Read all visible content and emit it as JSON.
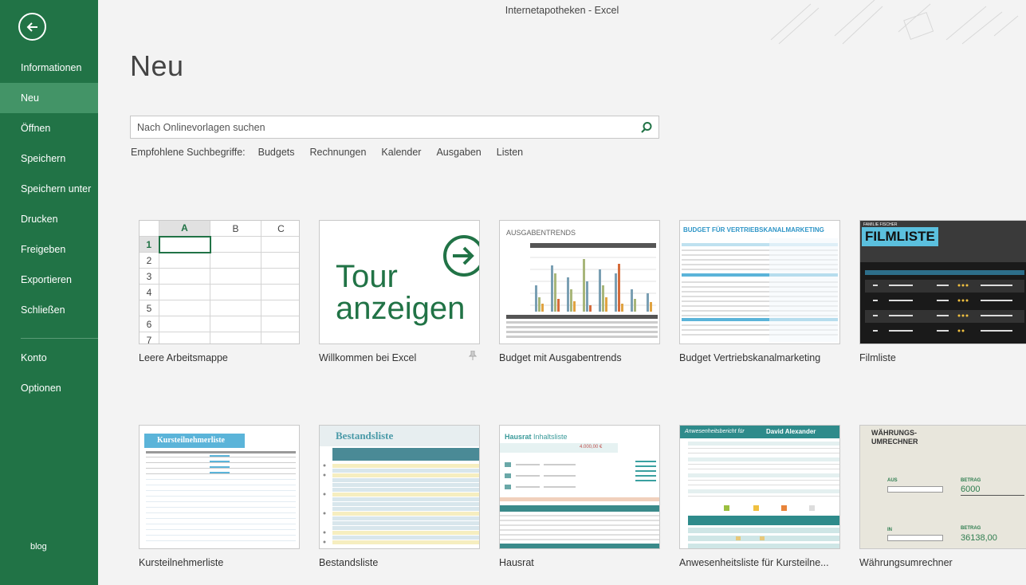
{
  "window": {
    "title": "Internetapotheken - Excel"
  },
  "sidebar": {
    "back_label": "",
    "items": [
      {
        "label": "Informationen"
      },
      {
        "label": "Neu"
      },
      {
        "label": "Öffnen"
      },
      {
        "label": "Speichern"
      },
      {
        "label": "Speichern unter"
      },
      {
        "label": "Drucken"
      },
      {
        "label": "Freigeben"
      },
      {
        "label": "Exportieren"
      },
      {
        "label": "Schließen"
      },
      {
        "label": "Konto"
      },
      {
        "label": "Optionen"
      }
    ],
    "blog": "blog"
  },
  "page": {
    "title": "Neu"
  },
  "search": {
    "placeholder": "Nach Onlinevorlagen suchen"
  },
  "suggestions": {
    "label": "Empfohlene Suchbegriffe:",
    "links": [
      "Budgets",
      "Rechnungen",
      "Kalender",
      "Ausgaben",
      "Listen"
    ]
  },
  "blank": {
    "cols": [
      "A",
      "B",
      "C"
    ],
    "rows": [
      "1",
      "2",
      "3",
      "4",
      "5",
      "6",
      "7"
    ]
  },
  "tour": {
    "line1": "Tour",
    "line2": "anzeigen"
  },
  "thumbs": {
    "ausgaben": "AUSGABENTRENDS",
    "vertrieb": "BUDGET FÜR VERTRIEBSKANALMARKETING",
    "film_small": "FAMILIE FISCHER",
    "film": "FILMLISTE",
    "kurs": "Kursteilnehmerliste",
    "bestand": "Bestandsliste",
    "hausrat": "Hausrat",
    "hausrat_sub": "Inhaltsliste",
    "hausrat_value": "4.000,00 €",
    "anwesen": "Anwesenheitsbericht für",
    "anwesen_name": "David Alexander",
    "waehrung": "WÄHRUNGS-\nUMRECHNER",
    "w_aus": "AUS",
    "w_in": "IN",
    "w_betrag": "BETRAG",
    "w_v1": "6000",
    "w_v2": "36138,00"
  },
  "templates": [
    {
      "label": "Leere Arbeitsmappe"
    },
    {
      "label": "Willkommen bei Excel"
    },
    {
      "label": "Budget mit Ausgabentrends"
    },
    {
      "label": "Budget Vertriebskanalmarketing"
    },
    {
      "label": "Filmliste"
    },
    {
      "label": "Kursteilnehmerliste"
    },
    {
      "label": "Bestandsliste"
    },
    {
      "label": "Hausrat"
    },
    {
      "label": "Anwesenheitsliste für Kursteilne..."
    },
    {
      "label": "Währungsumrechner"
    }
  ],
  "colors": {
    "excel_green": "#217346",
    "active_nav": "#439467"
  }
}
